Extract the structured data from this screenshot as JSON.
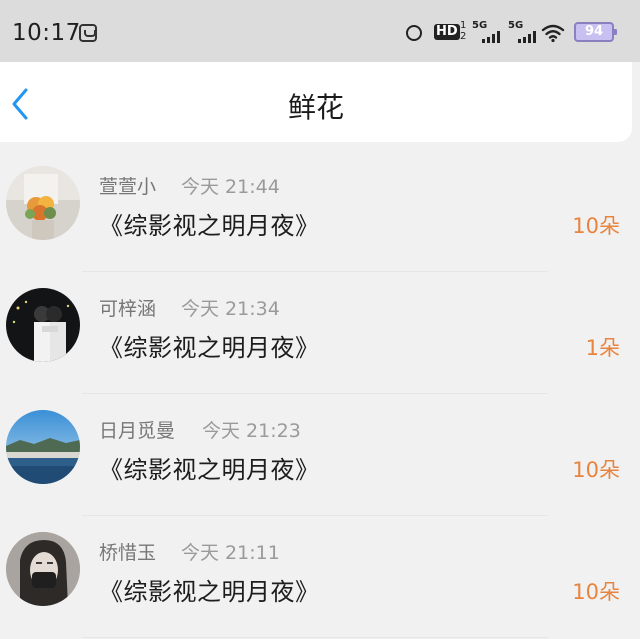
{
  "status_bar": {
    "time": "10:17",
    "hd_label": "HD",
    "hd_sub": "1 2",
    "signal1_label": "5G",
    "signal2_label": "5G",
    "battery": "94"
  },
  "header": {
    "title": "鲜花"
  },
  "gifts": [
    {
      "username": "萱萱小",
      "time": "今天 21:44",
      "book": "《综影视之明月夜》",
      "amount": "10朵"
    },
    {
      "username": "可梓涵",
      "time": "今天 21:34",
      "book": "《综影视之明月夜》",
      "amount": "1朵"
    },
    {
      "username": "日月觅曼",
      "time": "今天 21:23",
      "book": "《综影视之明月夜》",
      "amount": "10朵"
    },
    {
      "username": "桥惜玉",
      "time": "今天 21:11",
      "book": "《综影视之明月夜》",
      "amount": "10朵"
    }
  ],
  "colors": {
    "accent_blue": "#2196f3",
    "amount_orange": "#e8843e"
  }
}
